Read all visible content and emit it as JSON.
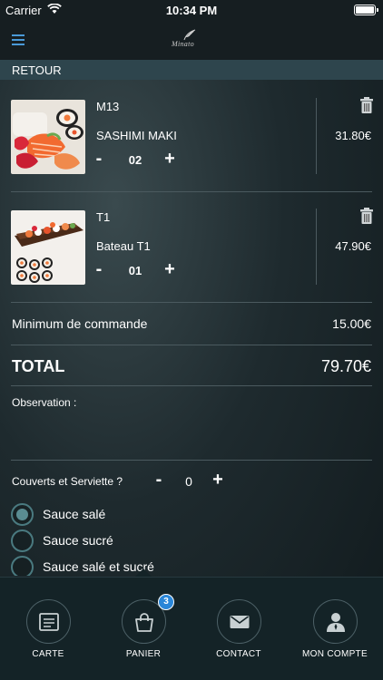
{
  "status_bar": {
    "carrier": "Carrier",
    "time": "10:34 PM"
  },
  "header": {
    "logo_text": "Minato",
    "back_label": "RETOUR"
  },
  "cart_items": [
    {
      "code": "M13",
      "name": "SASHIMI MAKI",
      "quantity": "02",
      "price": "31.80€",
      "minus": "-",
      "plus": "+"
    },
    {
      "code": "T1",
      "name": "Bateau T1",
      "quantity": "01",
      "price": "47.90€",
      "minus": "-",
      "plus": "+"
    }
  ],
  "summary": {
    "minimum_label": "Minimum de commande",
    "minimum_value": "15.00€",
    "total_label": "TOTAL",
    "total_value": "79.70€"
  },
  "observation": {
    "label": "Observation :"
  },
  "cutlery": {
    "label": "Couverts et Serviette ?",
    "value": "0",
    "minus": "-",
    "plus": "+"
  },
  "sauce_options": [
    {
      "label": "Sauce salé",
      "checked": true
    },
    {
      "label": "Sauce sucré",
      "checked": false
    },
    {
      "label": "Sauce salé et sucré",
      "checked": false
    }
  ],
  "tabs": [
    {
      "label": "CARTE",
      "icon": "menu-card-icon"
    },
    {
      "label": "PANIER",
      "icon": "shopping-bag-icon",
      "badge": "3",
      "active": true
    },
    {
      "label": "CONTACT",
      "icon": "envelope-icon"
    },
    {
      "label": "MON COMPTE",
      "icon": "user-icon"
    }
  ],
  "colors": {
    "accent": "#2a86d8",
    "menu_icon": "#4a9ad8",
    "back_bar": "#2e454d",
    "tab_bar": "#142327"
  }
}
